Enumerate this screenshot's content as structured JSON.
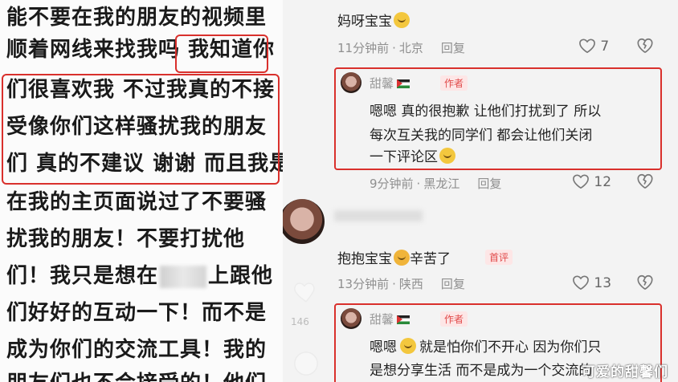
{
  "left_text": {
    "lines": [
      "能不要在我的朋友的视频里",
      "顺着网线来找我吗 我知道你",
      "们很喜欢我 不过我真的不接",
      "受像你们这样骚扰我的朋友",
      "们 真的不建议 谢谢 而且我是",
      "在我的主页面说过了不要骚",
      "扰我的朋友！不要打扰他",
      "们！我只是想在",
      "上跟他",
      "们好好的互动一下！而不是",
      "成为你们的交流工具！我的",
      "朋友们也不会接受的！他们"
    ]
  },
  "comments": {
    "c1": {
      "text": "妈呀宝宝",
      "time": "11分钟前",
      "location": "北京",
      "reply": "回复",
      "likes": "7"
    },
    "c2": {
      "author": "甜馨",
      "badge": "作者",
      "line1": "嗯嗯 真的很抱歉 让他们打扰到了 所以",
      "line2": "每次互关我的同学们 都会让他们关闭",
      "line3": "一下评论区",
      "time": "9分钟前",
      "location": "黑龙江",
      "reply": "回复",
      "likes": "12"
    },
    "c3": {
      "text_a": "抱抱宝宝",
      "text_b": "辛苦了",
      "first_badge": "首评",
      "time": "13分钟前",
      "location": "陕西",
      "reply": "回复",
      "likes": "13"
    },
    "c4": {
      "author": "甜馨",
      "badge": "作者",
      "line1a": "嗯嗯",
      "line1b": "就是怕你们不开心 因为你们只",
      "line2": "是想分享生活 而不是成为一个交流的"
    }
  },
  "side": {
    "ghost_count": "146"
  },
  "watermark": "可爱的甜馨们",
  "colors": {
    "highlight": "#d9302c",
    "badge_text": "#e14a4a",
    "badge_bg": "#fde6e6"
  }
}
